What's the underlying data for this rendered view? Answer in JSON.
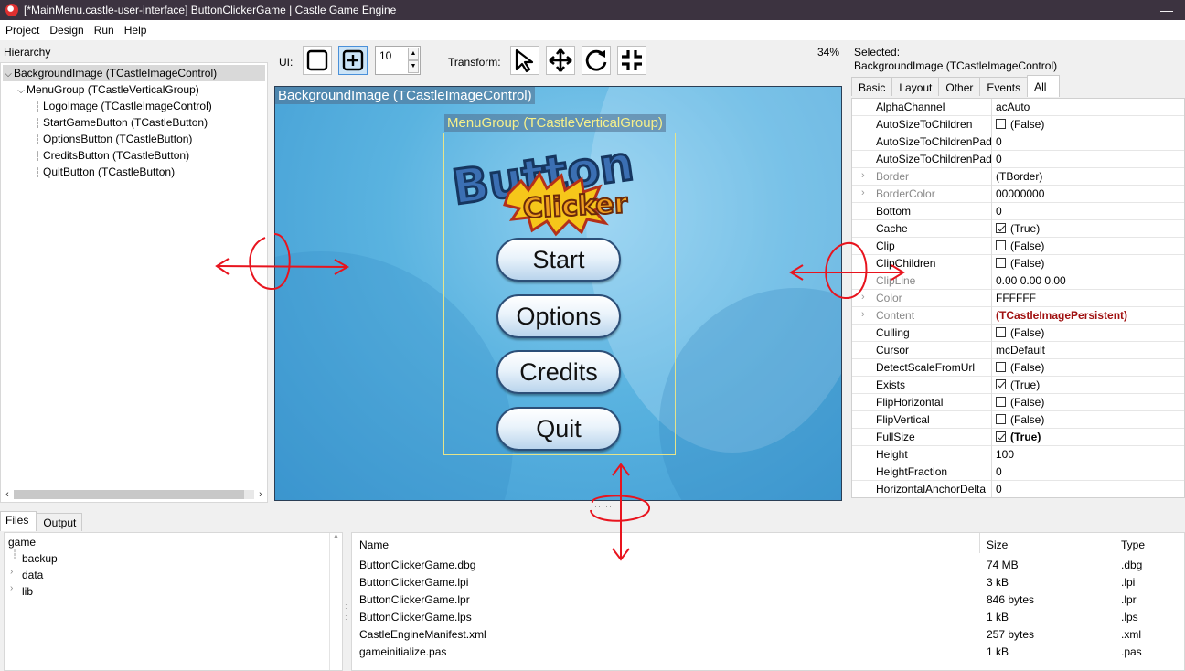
{
  "window": {
    "title": "[*MainMenu.castle-user-interface] ButtonClickerGame | Castle Game Engine",
    "minimize_glyph": "—"
  },
  "menubar": [
    "Project",
    "Design",
    "Run",
    "Help"
  ],
  "hierarchy": {
    "label": "Hierarchy",
    "items": [
      {
        "label": "BackgroundImage (TCastleImageControl)",
        "depth": 0,
        "expanded": true,
        "selected": true
      },
      {
        "label": "MenuGroup (TCastleVerticalGroup)",
        "depth": 1,
        "expanded": true,
        "selected": false
      },
      {
        "label": "LogoImage (TCastleImageControl)",
        "depth": 2,
        "selected": false
      },
      {
        "label": "StartGameButton (TCastleButton)",
        "depth": 2,
        "selected": false
      },
      {
        "label": "OptionsButton (TCastleButton)",
        "depth": 2,
        "selected": false
      },
      {
        "label": "CreditsButton (TCastleButton)",
        "depth": 2,
        "selected": false
      },
      {
        "label": "QuitButton (TCastleButton)",
        "depth": 2,
        "selected": false
      }
    ]
  },
  "toolbar": {
    "ui_label": "UI:",
    "spin_value": "10",
    "transform_label": "Transform:",
    "zoom": "34%",
    "tools": [
      "select-tool-icon",
      "move-tool-icon",
      "rotate-tool-icon",
      "resize-tool-icon"
    ]
  },
  "viewport": {
    "background_label": "BackgroundImage (TCastleImageControl)",
    "menugroup_label": "MenuGroup (TCastleVerticalGroup)",
    "logo_line1": "Button",
    "logo_line2": "Clicker",
    "buttons": [
      "Start",
      "Options",
      "Credits",
      "Quit"
    ],
    "splitter": "······"
  },
  "inspector": {
    "selected_label": "Selected:",
    "selected_name": "BackgroundImage (TCastleImageControl)",
    "tabs": [
      "Basic",
      "Layout",
      "Other",
      "Events",
      "All"
    ],
    "active_tab": "All",
    "properties": [
      {
        "name": "AlphaChannel",
        "value": "acAuto"
      },
      {
        "name": "AutoSizeToChildren",
        "value": "(False)",
        "check": false
      },
      {
        "name": "AutoSizeToChildrenPaddingRight",
        "value": "0"
      },
      {
        "name": "AutoSizeToChildrenPaddingTop",
        "value": "0"
      },
      {
        "name": "Border",
        "value": "(TBorder)",
        "expandable": true,
        "dim": true
      },
      {
        "name": "BorderColor",
        "value": "00000000",
        "expandable": true,
        "dim": true
      },
      {
        "name": "Bottom",
        "value": "0"
      },
      {
        "name": "Cache",
        "value": "(True)",
        "check": true
      },
      {
        "name": "Clip",
        "value": "(False)",
        "check": false
      },
      {
        "name": "ClipChildren",
        "value": "(False)",
        "check": false
      },
      {
        "name": "ClipLine",
        "value": "0.00 0.00 0.00",
        "dim": true
      },
      {
        "name": "Color",
        "value": "FFFFFF",
        "expandable": true,
        "dim": true
      },
      {
        "name": "Content",
        "value": "(TCastleImagePersistent)",
        "expandable": true,
        "dim": true,
        "style": "red"
      },
      {
        "name": "Culling",
        "value": "(False)",
        "check": false
      },
      {
        "name": "Cursor",
        "value": "mcDefault"
      },
      {
        "name": "DetectScaleFromUrl",
        "value": "(False)",
        "check": false
      },
      {
        "name": "Exists",
        "value": "(True)",
        "check": true
      },
      {
        "name": "FlipHorizontal",
        "value": "(False)",
        "check": false
      },
      {
        "name": "FlipVertical",
        "value": "(False)",
        "check": false
      },
      {
        "name": "FullSize",
        "value": "(True)",
        "check": true,
        "style": "bold"
      },
      {
        "name": "Height",
        "value": "100"
      },
      {
        "name": "HeightFraction",
        "value": "0"
      },
      {
        "name": "HorizontalAnchorDelta",
        "value": "0"
      }
    ]
  },
  "bottom": {
    "tabs": [
      "Files",
      "Output"
    ],
    "active_tab": "Files",
    "tree": [
      {
        "label": "game",
        "depth": 0
      },
      {
        "label": "backup",
        "depth": 1,
        "expandable": false
      },
      {
        "label": "data",
        "depth": 1,
        "expandable": true
      },
      {
        "label": "lib",
        "depth": 1,
        "expandable": true
      }
    ],
    "columns": [
      "Name",
      "Size",
      "Type"
    ],
    "files": [
      {
        "name": "ButtonClickerGame.dbg",
        "size": "74 MB",
        "type": ".dbg"
      },
      {
        "name": "ButtonClickerGame.lpi",
        "size": "3 kB",
        "type": ".lpi"
      },
      {
        "name": "ButtonClickerGame.lpr",
        "size": "846 bytes",
        "type": ".lpr"
      },
      {
        "name": "ButtonClickerGame.lps",
        "size": "1 kB",
        "type": ".lps"
      },
      {
        "name": "CastleEngineManifest.xml",
        "size": "257 bytes",
        "type": ".xml"
      },
      {
        "name": "gameinitialize.pas",
        "size": "1 kB",
        "type": ".pas"
      }
    ]
  },
  "colors": {
    "annotation": "#e8141e",
    "titlebar": "#3c3340",
    "viewport_bg": "#5ab3e0",
    "menugroup_outline": "#e6e48a"
  }
}
